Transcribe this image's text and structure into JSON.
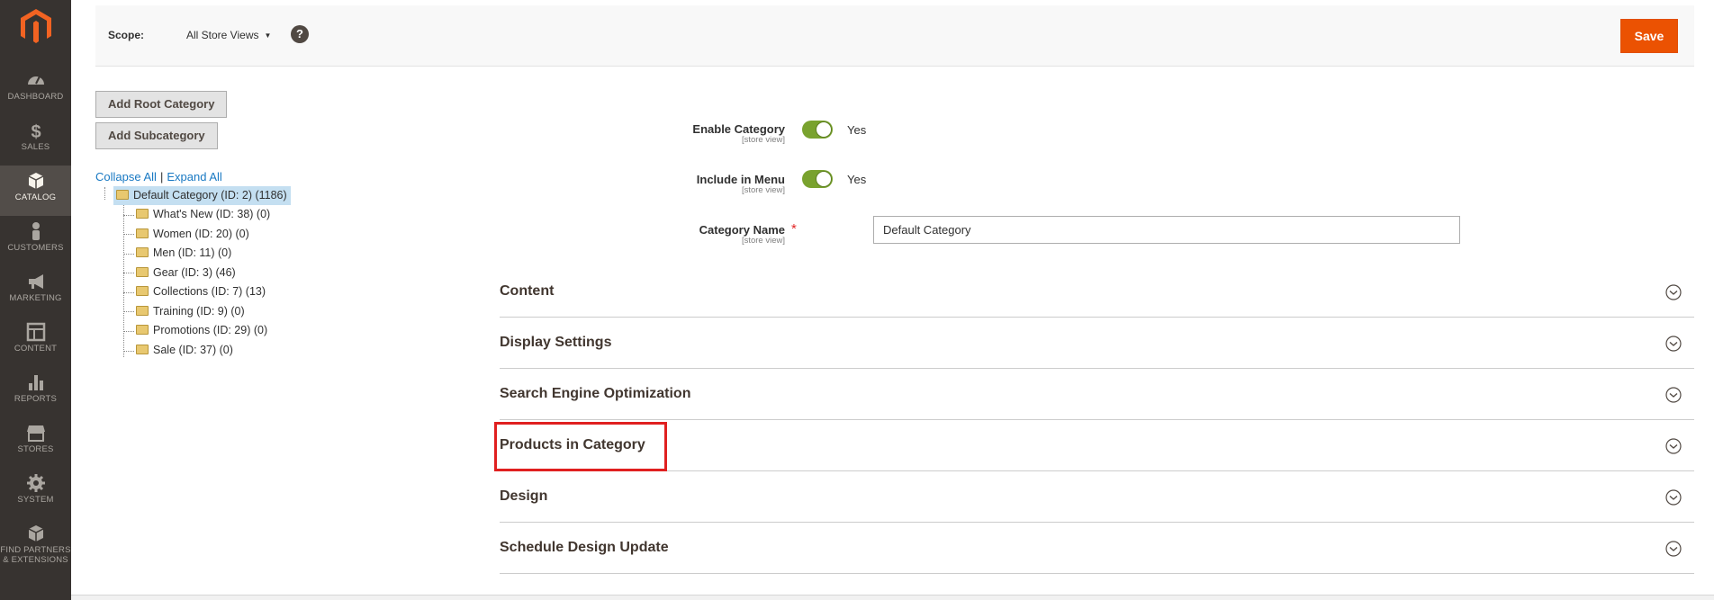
{
  "sidebar": {
    "logo": "magento-logo-icon",
    "items": [
      {
        "label": "DASHBOARD",
        "icon": "dashboard-icon",
        "active": false
      },
      {
        "label": "SALES",
        "icon": "dollar-icon",
        "active": false
      },
      {
        "label": "CATALOG",
        "icon": "cube-icon",
        "active": true
      },
      {
        "label": "CUSTOMERS",
        "icon": "person-icon",
        "active": false
      },
      {
        "label": "MARKETING",
        "icon": "megaphone-icon",
        "active": false
      },
      {
        "label": "CONTENT",
        "icon": "layout-icon",
        "active": false
      },
      {
        "label": "REPORTS",
        "icon": "bar-chart-icon",
        "active": false
      },
      {
        "label": "STORES",
        "icon": "store-icon",
        "active": false
      },
      {
        "label": "SYSTEM",
        "icon": "gear-icon",
        "active": false
      },
      {
        "label": "FIND PARTNERS & EXTENSIONS",
        "label_line1": "FIND PARTNERS",
        "label_line2": "& EXTENSIONS",
        "icon": "box-icon",
        "active": false
      }
    ]
  },
  "toolbar": {
    "scope_label": "Scope:",
    "scope_value": "All Store Views",
    "help": "?",
    "save_label": "Save"
  },
  "tree_panel": {
    "add_root_label": "Add Root Category",
    "add_sub_label": "Add Subcategory",
    "collapse_all": "Collapse All",
    "separator": "|",
    "expand_all": "Expand All",
    "root": "Default Category (ID: 2) (1186)",
    "children": [
      "What's New (ID: 38) (0)",
      "Women (ID: 20) (0)",
      "Men (ID: 11) (0)",
      "Gear (ID: 3) (46)",
      "Collections (ID: 7) (13)",
      "Training (ID: 9) (0)",
      "Promotions (ID: 29) (0)",
      "Sale (ID: 37) (0)"
    ]
  },
  "form": {
    "enable_category": {
      "label": "Enable Category",
      "scope": "[store view]",
      "value": "Yes"
    },
    "include_in_menu": {
      "label": "Include in Menu",
      "scope": "[store view]",
      "value": "Yes"
    },
    "category_name": {
      "label": "Category Name",
      "scope": "[store view]",
      "required": "*",
      "value": "Default Category"
    }
  },
  "sections": [
    "Content",
    "Display Settings",
    "Search Engine Optimization",
    "Products in Category",
    "Design",
    "Schedule Design Update"
  ],
  "colors": {
    "accent": "#eb5202",
    "sidebar": "#373330",
    "toggle_on": "#79a22e",
    "link": "#1979c3",
    "highlight": "#e02020"
  }
}
